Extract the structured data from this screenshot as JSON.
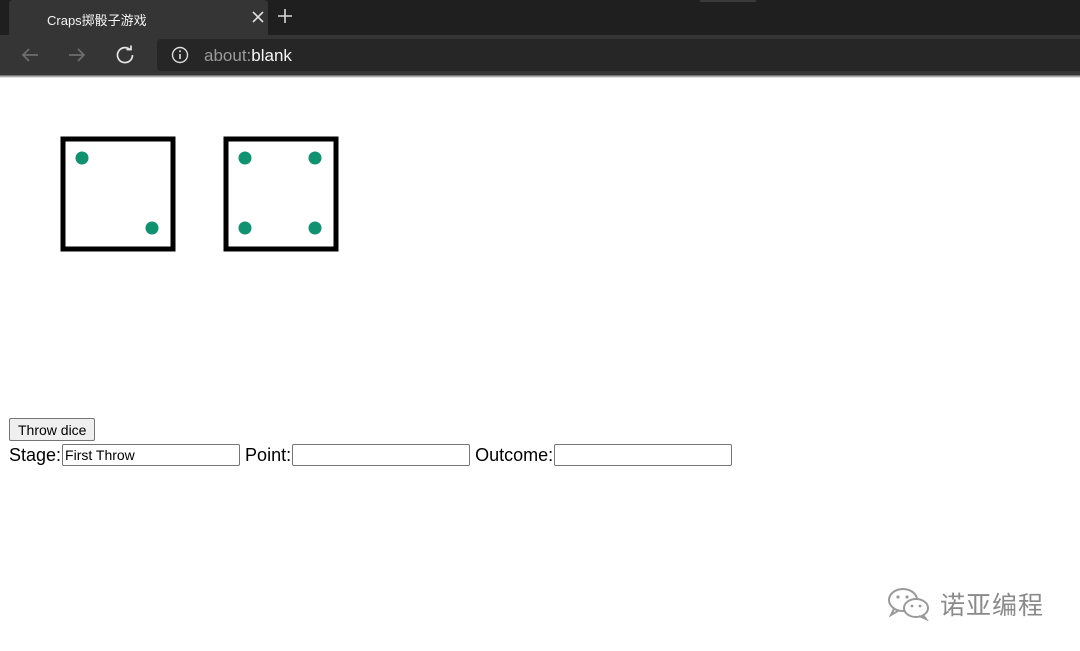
{
  "browser": {
    "tab_title": "Craps掷骰子游戏",
    "url_scheme": "about:",
    "url_host": "blank"
  },
  "dice": {
    "die1_value": 2,
    "die2_value": 4,
    "pip_color": "#0f9270",
    "border_color": "#000000"
  },
  "controls": {
    "throw_label": "Throw dice",
    "stage_label": "Stage:",
    "stage_value": "First Throw",
    "point_label": "Point:",
    "point_value": "",
    "outcome_label": "Outcome:",
    "outcome_value": ""
  },
  "watermark": {
    "text": "诺亚编程",
    "icon": "wechat-icon"
  }
}
